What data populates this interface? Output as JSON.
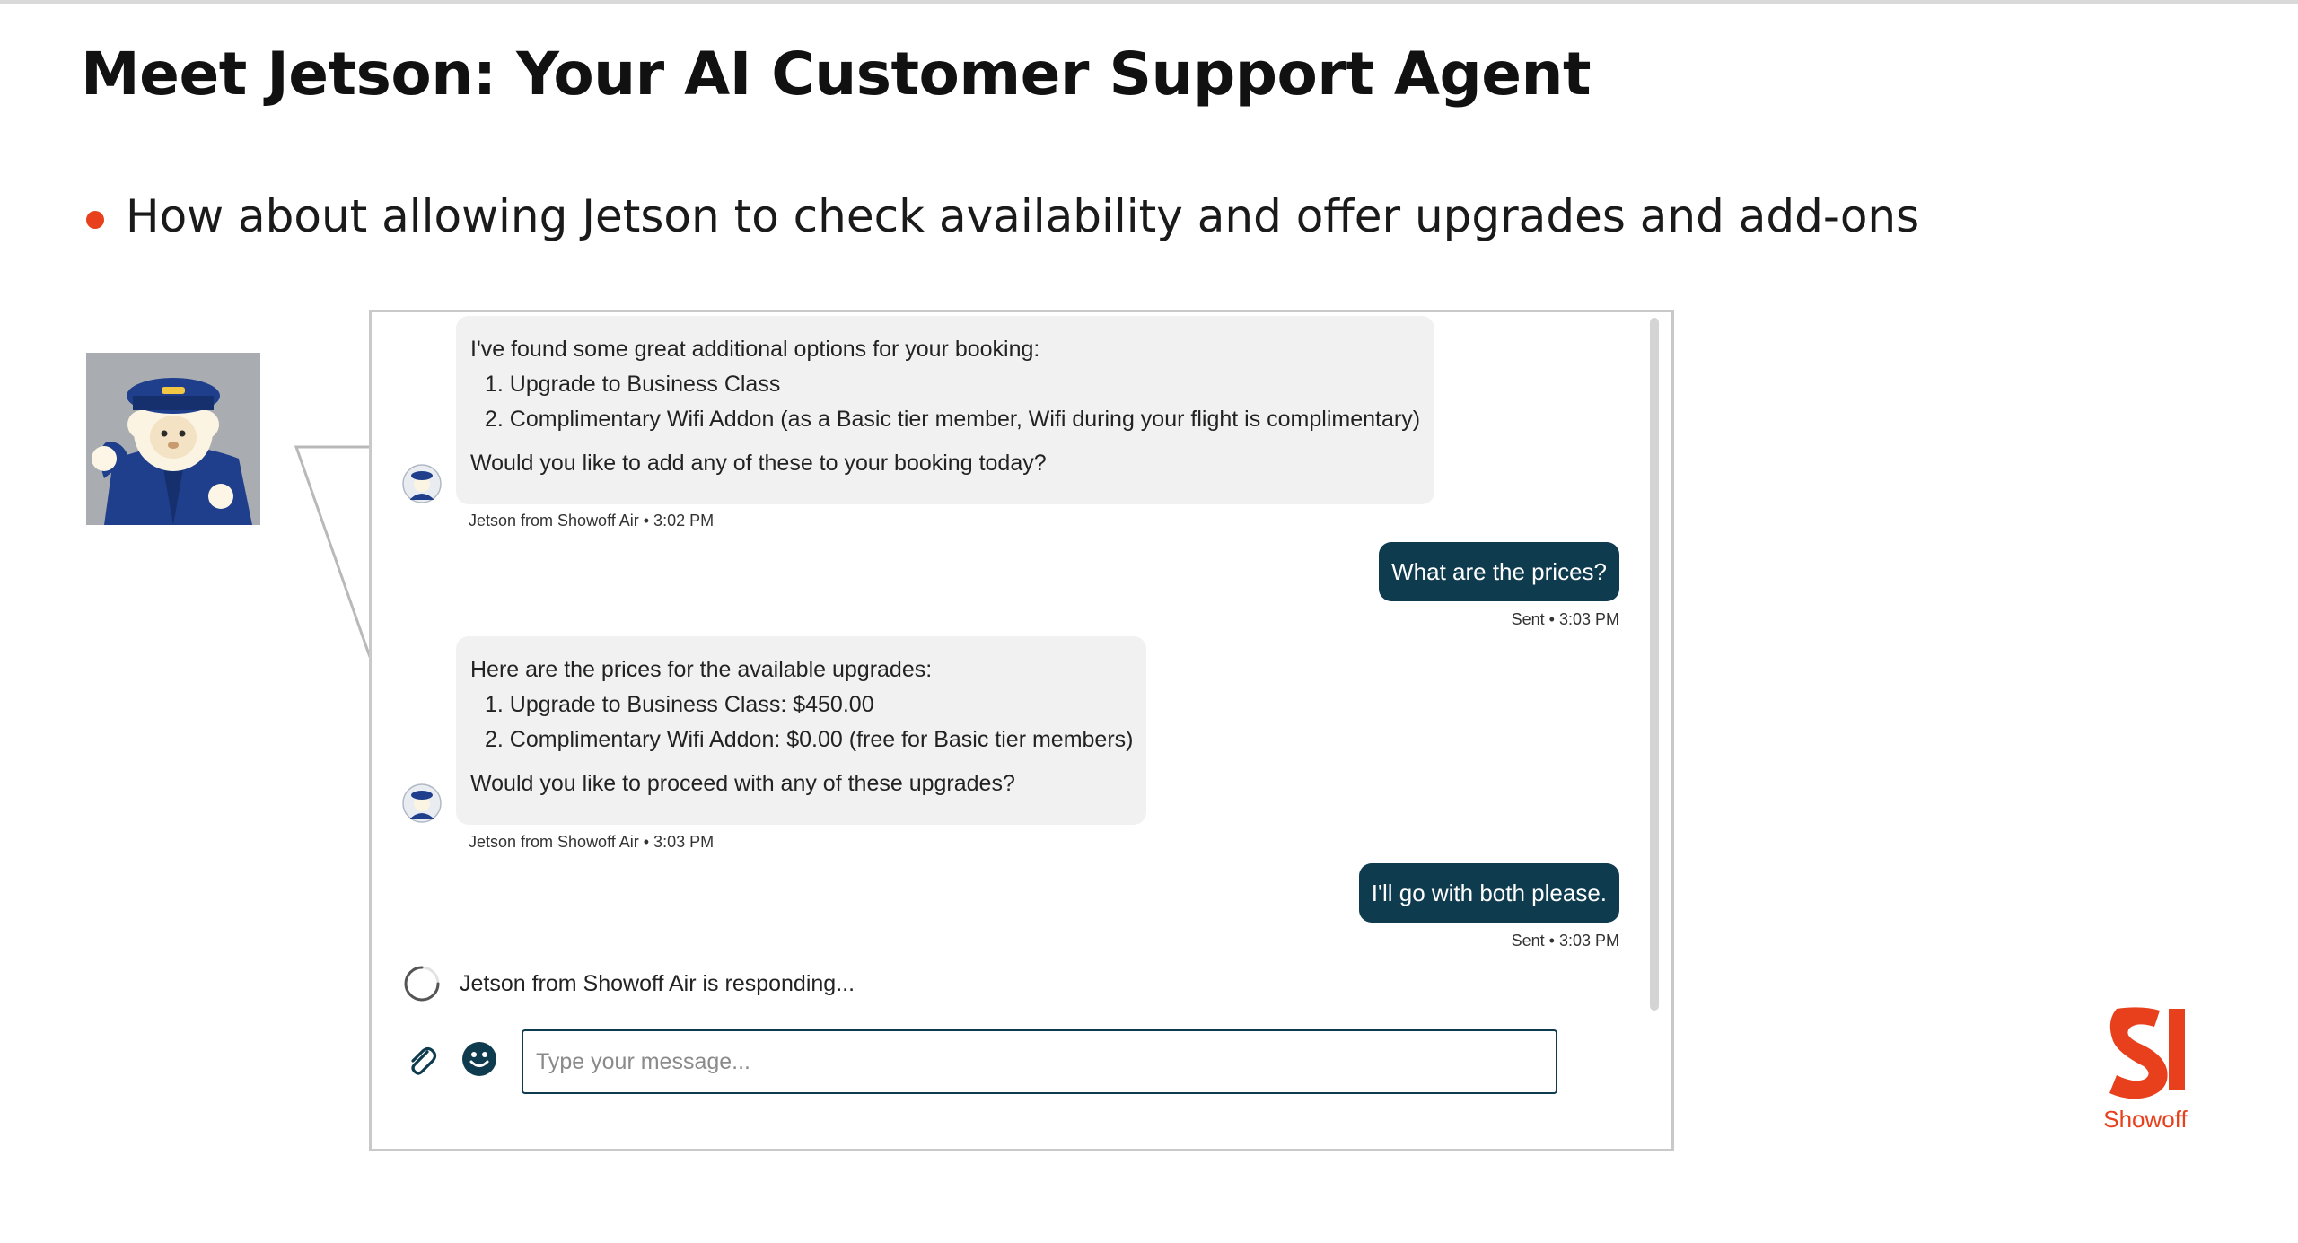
{
  "slide": {
    "title": "Meet Jetson: Your AI Customer Support Agent",
    "bullet": "How about allowing Jetson to check availability and offer upgrades and add-ons"
  },
  "colors": {
    "accent": "#e8401c",
    "user_bubble": "#0f3b4f",
    "agent_bubble": "#f1f1f1"
  },
  "icons": {
    "avatar": "pilot-sheep-avatar",
    "agent_icon": "jetson-avatar-icon",
    "spinner": "loading-spinner-icon",
    "attach": "paperclip-icon",
    "emoji": "smiley-icon",
    "brand": "showoff-logo"
  },
  "chat": {
    "messages": [
      {
        "from": "agent",
        "intro": "I've found some great additional options for your booking:",
        "items": [
          "1. Upgrade to Business Class",
          "2. Complimentary Wifi Addon (as a Basic tier member, Wifi during your flight is complimentary)"
        ],
        "question": "Would you like to add any of these to your booking today?",
        "meta": "Jetson from Showoff Air • 3:02 PM"
      },
      {
        "from": "user",
        "text": "What are the prices?",
        "meta": "Sent • 3:03 PM"
      },
      {
        "from": "agent",
        "intro": "Here are the prices for the available upgrades:",
        "items": [
          "1. Upgrade to Business Class: $450.00",
          "2. Complimentary Wifi Addon: $0.00 (free for Basic tier members)"
        ],
        "question": "Would you like to proceed with any of these upgrades?",
        "meta": "Jetson from Showoff Air • 3:03 PM"
      },
      {
        "from": "user",
        "text": "I'll go with both please.",
        "meta": "Sent • 3:03 PM"
      }
    ],
    "typing_indicator": "Jetson from Showoff Air is responding...",
    "input_placeholder": "Type your message...",
    "input_value": ""
  },
  "brand": {
    "name": "Showoff"
  }
}
